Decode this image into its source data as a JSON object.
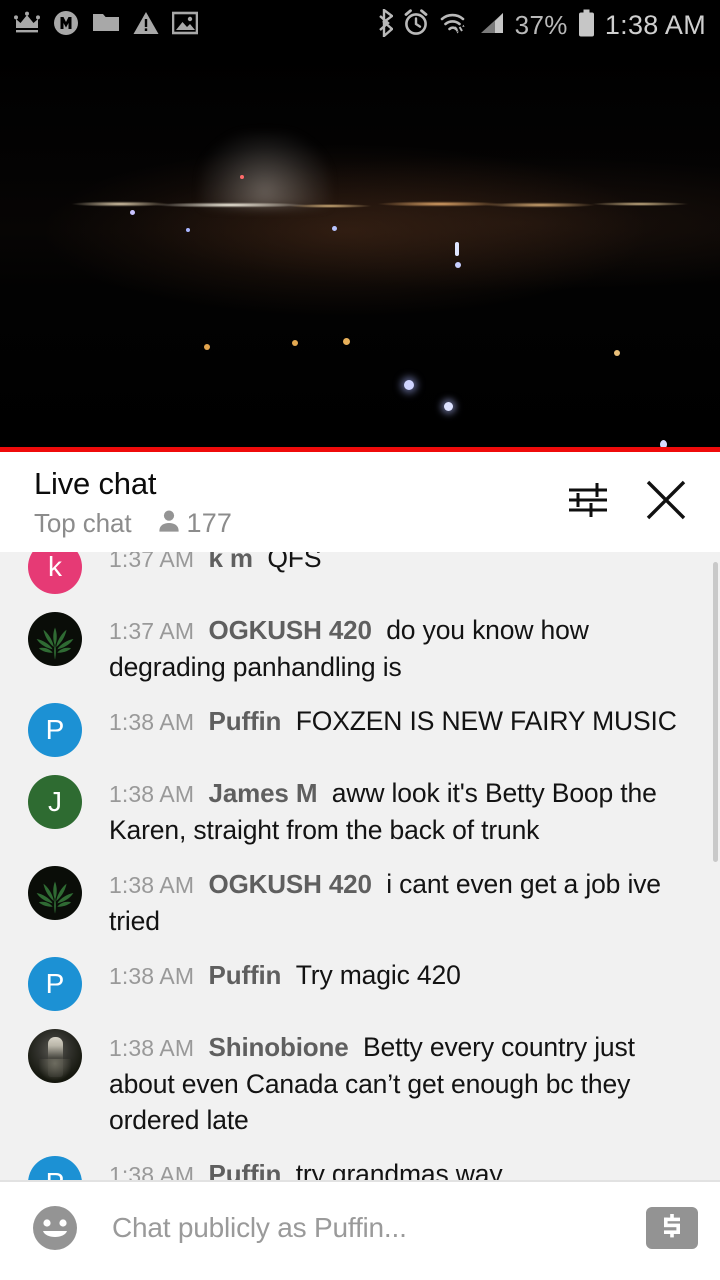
{
  "statusbar": {
    "left_icons": [
      "crown-icon",
      "circled-m-icon",
      "folder-icon",
      "warning-triangle-icon",
      "image-icon"
    ],
    "right_icons": [
      "bluetooth-icon",
      "alarm-clock-icon",
      "wifi-icon",
      "cell-signal-icon",
      "battery-icon"
    ],
    "battery_percent": "37%",
    "clock": "1:38 AM"
  },
  "video": {
    "description": "night cityscape live stream",
    "progress_percent": 100,
    "progress_color": "#ef0b0b"
  },
  "chat": {
    "title": "Live chat",
    "mode_label": "Top chat",
    "viewer_count": "177",
    "settings_icon": "sliders-icon",
    "close_icon": "close-icon",
    "messages": [
      {
        "time": "1:37 AM",
        "author": "k m",
        "text": "QFS",
        "avatar_kind": "initial",
        "avatar_initial": "k",
        "avatar_color": "#e63a75"
      },
      {
        "time": "1:37 AM",
        "author": "OGKUSH 420",
        "text": "do you know how degrading panhandling is",
        "avatar_kind": "leaf",
        "avatar_initial": "",
        "avatar_color": "#0a0d08"
      },
      {
        "time": "1:38 AM",
        "author": "Puffin",
        "text": "FOXZEN IS NEW FAIRY MUSIC",
        "avatar_kind": "initial",
        "avatar_initial": "P",
        "avatar_color": "#1c91d4"
      },
      {
        "time": "1:38 AM",
        "author": "James M",
        "text": "aww look it's Betty Boop the Karen, straight from the back of trunk",
        "avatar_kind": "initial",
        "avatar_initial": "J",
        "avatar_color": "#2e6b31"
      },
      {
        "time": "1:38 AM",
        "author": "OGKUSH 420",
        "text": "i cant even get a job ive tried",
        "avatar_kind": "leaf",
        "avatar_initial": "",
        "avatar_color": "#0a0d08"
      },
      {
        "time": "1:38 AM",
        "author": "Puffin",
        "text": "Try magic 420",
        "avatar_kind": "initial",
        "avatar_initial": "P",
        "avatar_color": "#1c91d4"
      },
      {
        "time": "1:38 AM",
        "author": "Shinobione",
        "text": "Betty every country just about even Canada can’t get enough bc they ordered late",
        "avatar_kind": "photo",
        "avatar_initial": "",
        "avatar_color": "#2b2c24"
      },
      {
        "time": "1:38 AM",
        "author": "Puffin",
        "text": "try grandmas way",
        "avatar_kind": "initial",
        "avatar_initial": "P",
        "avatar_color": "#1c91d4"
      }
    ]
  },
  "composer": {
    "emoji_icon": "emoji-smiley-icon",
    "placeholder": "Chat publicly as Puffin...",
    "value": "",
    "superchat_icon": "dollar-icon"
  }
}
